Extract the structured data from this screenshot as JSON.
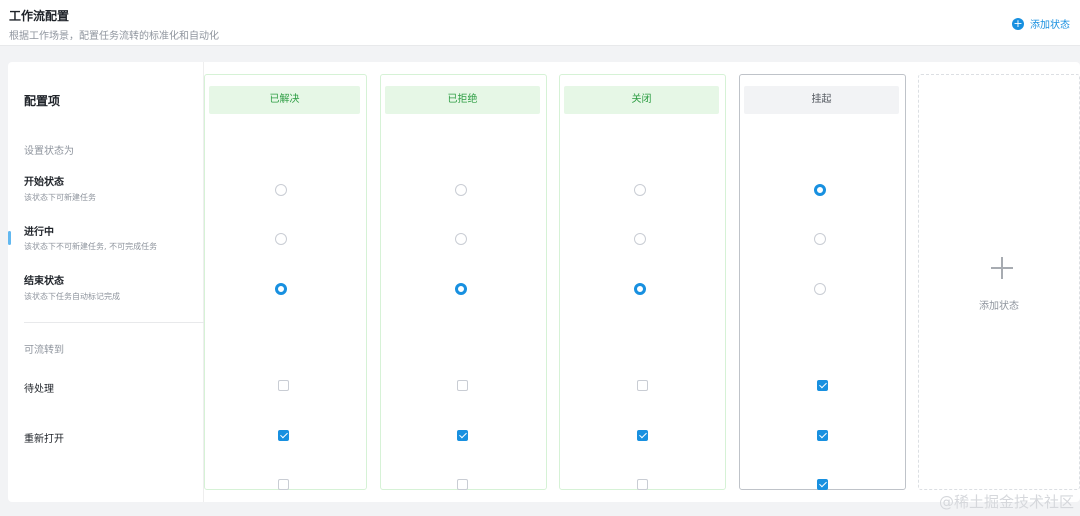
{
  "header": {
    "title": "工作流配置",
    "subtitle": "根据工作场景，配置任务流转的标准化和自动化",
    "add_status_label": "添加状态"
  },
  "config": {
    "title": "配置项",
    "set_status_section": "设置状态为",
    "rows": [
      {
        "title": "开始状态",
        "desc": "该状态下可新建任务"
      },
      {
        "title": "进行中",
        "desc": "该状态下不可新建任务, 不可完成任务"
      },
      {
        "title": "结束状态",
        "desc": "该状态下任务自动标记完成"
      }
    ],
    "transition_section": "可流转到",
    "transitions": [
      "待处理",
      "重新打开"
    ]
  },
  "status_columns": [
    {
      "name": "已解决",
      "group": "done",
      "state": "结束状态",
      "can_move_to": {
        "待处理": false,
        "重新打开": true,
        "third_row": false
      }
    },
    {
      "name": "已拒绝",
      "group": "done",
      "state": "结束状态",
      "can_move_to": {
        "待处理": false,
        "重新打开": true,
        "third_row": false
      }
    },
    {
      "name": "关闭",
      "group": "done",
      "state": "结束状态",
      "can_move_to": {
        "待处理": false,
        "重新打开": true,
        "third_row": false
      }
    },
    {
      "name": "挂起",
      "group": "pending",
      "state": "开始状态",
      "can_move_to": {
        "待处理": true,
        "重新打开": true,
        "third_row": true
      }
    }
  ],
  "add_column_label": "添加状态",
  "watermark": "@稀土掘金技术社区",
  "colors": {
    "accent": "#1890e0",
    "done_bg": "#e6f7e6",
    "done_text": "#2e9e44",
    "pending_bg": "#f2f3f5"
  }
}
